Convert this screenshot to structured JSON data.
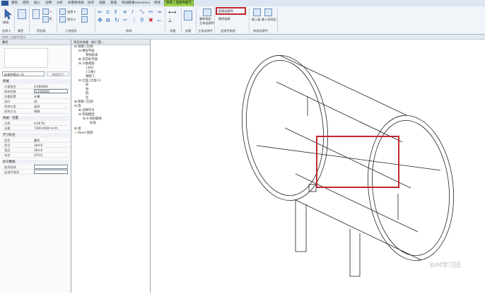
{
  "tabs": [
    "建筑",
    "结构",
    "插入",
    "注释",
    "分析",
    "体量和场地",
    "协作",
    "视图",
    "管理",
    "附加模块",
    "Extensions",
    "修改",
    "修改 | 连接件图元"
  ],
  "ribbon": {
    "modify_label": "修改",
    "group_labels": [
      "选择 ▾",
      "属性",
      "剪贴板",
      "几何图形",
      "修改",
      "测量",
      "创建",
      "主体连接件",
      "连接件链接",
      "修改连接件"
    ],
    "small_labels": [
      "连接 ▾",
      "剪切 ▾",
      "连接 ▾"
    ],
    "highlight_btn": "链接连接件",
    "remove_btn": "删除链接",
    "reassign": [
      "重新指定",
      "主体连接件"
    ],
    "insert_btns": [
      "载入族",
      "载入到项目"
    ]
  },
  "option_bar": "修改 | 连接件图元",
  "properties": {
    "title": "属性",
    "type_select": "连接件图元 (1)",
    "edit_type": "编辑类型",
    "sections": [
      {
        "name": "机械",
        "rows": [
          [
            "示意类型",
            "0.000000"
          ],
          [
            "损耗系数",
            "0.000000"
          ],
          [
            "流量配置",
            "计算"
          ],
          [
            "流向",
            "进"
          ],
          [
            "系统分类",
            "送风"
          ],
          [
            "损失方法",
            "系数"
          ]
        ]
      },
      {
        "name": "机械 - 流量",
        "rows": [
          [
            "压降",
            "0.00 Pa"
          ],
          [
            "流量",
            "7200.0000 m³/h"
          ]
        ]
      },
      {
        "name": "尺寸标注",
        "rows": [
          [
            "造型",
            "圆形"
          ],
          [
            "直径",
            "304.8"
          ],
          [
            "宽度",
            "304.8"
          ],
          [
            "半径",
            "270.0"
          ]
        ]
      },
      {
        "name": "标识数据",
        "rows": [
          [
            "使用链接",
            ""
          ],
          [
            "连接件描述",
            ""
          ]
        ]
      }
    ]
  },
  "browser": {
    "title": "项目浏览器 - 族1 [管...",
    "items": [
      "视图 (全部)",
      "楼层平面",
      "参照标高",
      "天花板平面",
      "三维视图",
      "{3D}",
      "{三维}",
      "视图 1",
      "立面 (立面 1)",
      "前",
      "右",
      "后",
      "左",
      "图纸 (全部)",
      "族",
      "注释符号",
      "常规模型",
      "4-风机箱体",
      "标准",
      "组",
      "Revit 链接"
    ]
  },
  "canvas": {
    "watermark": "BIM学习团",
    "accent": "#c0262e"
  }
}
